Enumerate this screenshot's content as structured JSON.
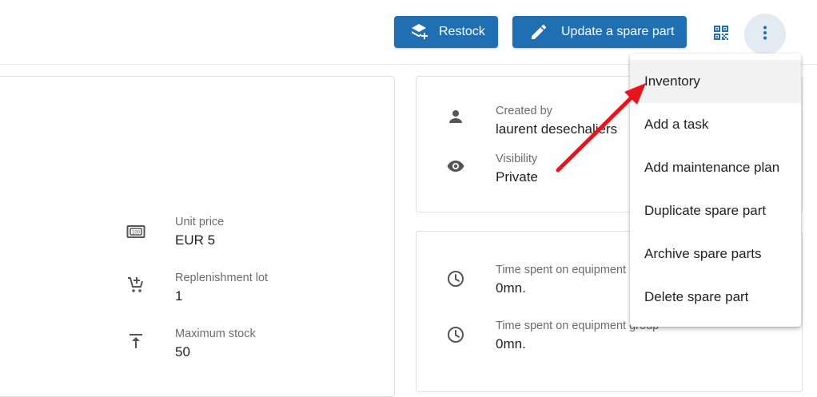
{
  "toolbar": {
    "restock_label": "Restock",
    "update_label": "Update a spare part",
    "qr_icon": "qr-code-icon",
    "more_icon": "more-vert-icon",
    "button_color": "#1f6fb2"
  },
  "left_card": {
    "fields": [
      {
        "icon": "banknote-icon",
        "label": "Unit price",
        "value": "EUR 5"
      },
      {
        "icon": "cart-plus-icon",
        "label": "Replenishment lot",
        "value": "1"
      },
      {
        "icon": "max-stock-icon",
        "label": "Maximum stock",
        "value": "50"
      }
    ]
  },
  "info_card": {
    "fields": [
      {
        "icon": "person-icon",
        "label": "Created by",
        "value": "laurent desechaliers"
      },
      {
        "icon": "eye-icon",
        "label": "Visibility",
        "value": "Private"
      }
    ]
  },
  "time_card": {
    "fields": [
      {
        "icon": "clock-icon",
        "label": "Time spent on equipment",
        "value": "0mn."
      },
      {
        "icon": "clock-icon",
        "label": "Time spent on equipment group",
        "value": "0mn."
      }
    ]
  },
  "menu": {
    "items": [
      {
        "label": "Inventory",
        "active": true
      },
      {
        "label": "Add a task"
      },
      {
        "label": "Add maintenance plan"
      },
      {
        "label": "Duplicate spare part"
      },
      {
        "label": "Archive spare parts"
      },
      {
        "label": "Delete spare part"
      }
    ]
  },
  "annotation": {
    "arrow_color": "#e8141b"
  }
}
